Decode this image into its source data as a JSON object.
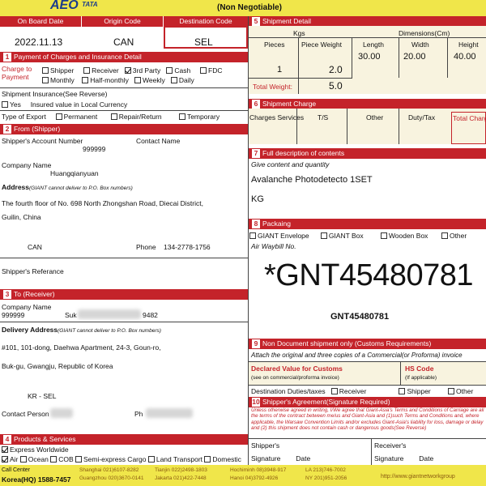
{
  "brand": {
    "name": "AEO",
    "sub": "TATA"
  },
  "header": {
    "title_partial": "Shipment ... (Non Negotiable)",
    "subtitle": "(Non Negotiable)"
  },
  "top": {
    "onboard_label": "On Board Date",
    "origin_label": "Origin Code",
    "dest_label": "Destination Code",
    "onboard_date": "2022.11.13",
    "origin_code": "CAN",
    "dest_code": "SEL"
  },
  "payment": {
    "section": "Payment of Charges and Insurance Detail",
    "charge_to": "Charge to Payment",
    "options_row1": [
      "Shipper",
      "Receiver",
      "3rd Party",
      "Cash",
      "FDC"
    ],
    "options_row2": [
      "Monthly",
      "Half-monthly",
      "Weekly",
      "Daily"
    ],
    "insurance": "Shipment Insurance(See Reverse)",
    "insurance_yes": "Yes",
    "insurance_note": "Insured value in Local Currency",
    "export_type": "Type of Export",
    "export_opts": [
      "Permanent",
      "Repair/Return",
      "Temporary"
    ]
  },
  "shipper": {
    "section": "From (Shipper)",
    "account_label": "Shipper's Account Number",
    "account_value": "999999",
    "contact_label": "Contact Name",
    "company_label": "Company Name",
    "company_value": "Huangqianyuan",
    "address_label": "Address",
    "address_note": "(GIANT cannot deliver to P.O. Box numbers)",
    "address_line1": "The fourth floor of No. 698 North Zhongshan Road, Diecai District,",
    "address_line2": "Guilin, China",
    "city": "CAN",
    "phone_label": "Phone",
    "phone_value": "134-2778-1756",
    "reference_label": "Shipper's Referance"
  },
  "receiver": {
    "section": "To (Receiver)",
    "company_label": "Company Name",
    "company_value": "999999",
    "company_partial": "Suk",
    "company_suffix": "9482",
    "delivery_label": "Delivery Address",
    "delivery_note": "(GIANT cannot deliver to P.O. Box numbers)",
    "address_line1": "#101, 101-dong, Daehwa Apartment, 24-3, Goun-ro,",
    "address_line2": "Buk-gu, Gwangju, Republic of Korea",
    "city": "KR - SEL",
    "contact_label": "Contact Person",
    "phone_label": "Ph"
  },
  "products": {
    "section": "Products & Services",
    "express": "Express Worldwide",
    "modes": [
      "Air",
      "Ocean",
      "COB",
      "Semi-express Cargo",
      "Land Transport",
      "Domestic"
    ]
  },
  "footer": {
    "call_center": "Call Center",
    "hq": "Korea(HQ) 1588-7457",
    "offices": [
      [
        "Shanghai",
        "021)6107-8282"
      ],
      [
        "Tianjin",
        "022)2498-1803"
      ],
      [
        "Hochiminh",
        "08)3948-917"
      ],
      [
        "LA",
        "213)746-7002"
      ],
      [
        "Guangzhou",
        "020)3670-0141"
      ],
      [
        "Jakarta",
        "021)422-7448"
      ],
      [
        "Hanoi",
        "04)3792-4926"
      ],
      [
        "NY",
        "201)951-2056"
      ]
    ],
    "website": "http://www.giantnetworkgroup"
  },
  "shipment_detail": {
    "section": "Shipment Detail",
    "kgs": "Kgs",
    "dimensions": "Dimensions(Cm)",
    "cols": [
      "Pieces",
      "Piece Weight",
      "Length",
      "Width",
      "Height"
    ],
    "pieces": "1",
    "piece_weight": "2.0",
    "length": "30.00",
    "width": "20.00",
    "height": "40.00",
    "total_label": "Total Weight:",
    "total_value": "5.0"
  },
  "charges": {
    "section": "Shipment Charge",
    "cols": [
      "Charges Services",
      "T/S",
      "Other",
      "Duty/Tax",
      "Total Charge"
    ]
  },
  "contents": {
    "section": "Full description of contents",
    "hint": "Give content and quantity",
    "line1": "Avalanche Photodetecto 1SET",
    "line2": "KG"
  },
  "packing": {
    "section": "Packaing",
    "options": [
      "GIANT Envelope",
      "GIANT Box",
      "Wooden Box",
      "Other"
    ],
    "waybill_label": "Air Waybill No.",
    "waybill_big": "*GNT45480781",
    "waybill_small": "GNT45480781"
  },
  "customs": {
    "section": "Non Document shipment only (Customs Requirements)",
    "note": "Attach the original and three copies of a Commercial(or Proforma) invoice",
    "declared_label": "Declared Value for Customs",
    "declared_sub": "(see on commercial/proforma invoice)",
    "hs_label": "HS Code",
    "hs_sub": "(If applicable)",
    "duties_label": "Destination Duties/taxes",
    "duties_opts": [
      "Receiver",
      "Shipper",
      "Other"
    ]
  },
  "agreement": {
    "section": "Shipper's Agreement(Signature Required)",
    "text": "Unless otherwise agreed in writing, I/We agree that Giant-Asia's Terms and Conditions of Carriage are all the terms of the contract between me/us and Giant-Asia and (1)such Terms and Conditions and, where applicable, the Warsaw Convention Limits and/or excludes Giant-Asia's liability for loss, damage or delay and (2) this shipment does not contain cash or dangerous goods(See Reverse)",
    "shipper_label": "Shipper's",
    "receiver_label": "Receiver's",
    "signature": "Signature",
    "date": "Date"
  }
}
